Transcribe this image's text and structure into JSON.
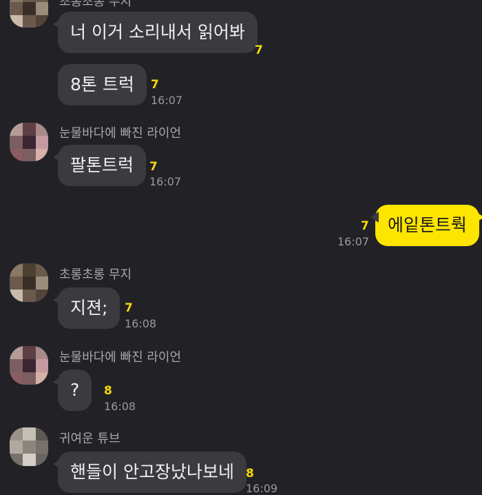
{
  "messages": [
    {
      "sender": "초롱초롱 무지",
      "text": "너 이거 소리내서 읽어봐",
      "unread": "7"
    },
    {
      "text": "8톤 트럭",
      "unread": "7",
      "time": "16:07"
    },
    {
      "sender": "눈물바다에 빠진 라이언",
      "text": "팔톤트럭",
      "unread": "7",
      "time": "16:07"
    },
    {
      "text": "에잍톤트뤅",
      "unread": "7",
      "time": "16:07"
    },
    {
      "sender": "초롱초롱 무지",
      "text": "지젼;",
      "unread": "7",
      "time": "16:08"
    },
    {
      "sender": "눈물바다에 빠진 라이언",
      "text": "?",
      "unread": "8",
      "time": "16:08"
    },
    {
      "sender": "귀여운 튜브",
      "text": "핸들이 안고장났나보네",
      "unread": "8",
      "time": "16:09"
    }
  ],
  "colors": {
    "background": "#222226",
    "incoming_bubble": "#3a3a3f",
    "outgoing_bubble": "#fee500",
    "unread_count": "#f5d90a"
  }
}
